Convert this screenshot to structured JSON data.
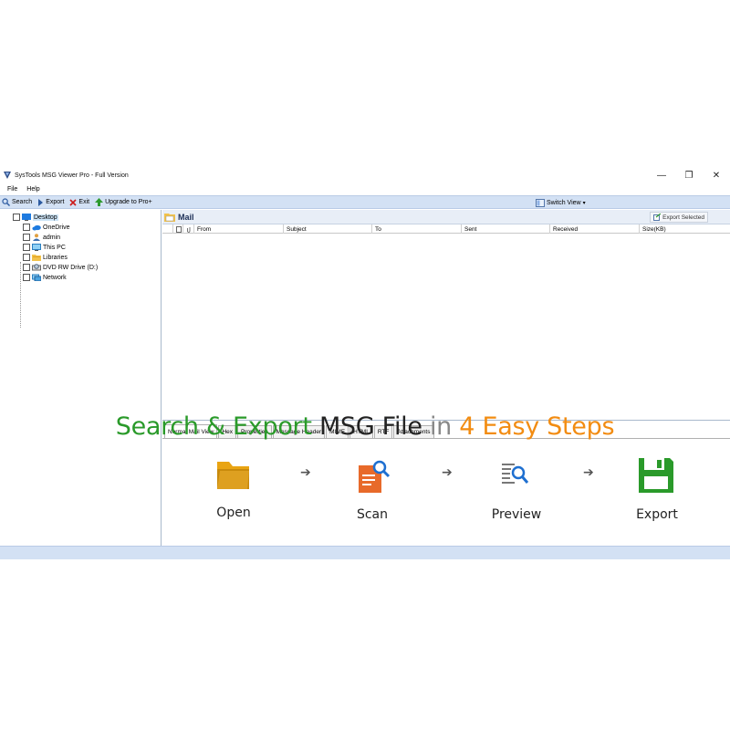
{
  "window": {
    "title": "SysTools MSG Viewer Pro - Full Version",
    "minimize_glyph": "—",
    "restore_glyph": "❐",
    "close_glyph": "✕"
  },
  "menu": [
    "File",
    "Help"
  ],
  "toolbar": {
    "search": "Search",
    "export": "Export",
    "exit": "Exit",
    "upgrade": "Upgrade to Pro+",
    "switch_view": "Switch View",
    "switch_view_caret": "▾"
  },
  "tree": [
    {
      "label": "Desktop",
      "icon": "desktop-icon",
      "selected": true
    },
    {
      "label": "OneDrive",
      "icon": "cloud-icon"
    },
    {
      "label": "admin",
      "icon": "user-icon"
    },
    {
      "label": "This PC",
      "icon": "computer-icon"
    },
    {
      "label": "Libraries",
      "icon": "folder-icon"
    },
    {
      "label": "DVD RW Drive (D:)",
      "icon": "dvd-drive-icon"
    },
    {
      "label": "Network",
      "icon": "network-icon"
    }
  ],
  "mail": {
    "title": "Mail",
    "export_selected": "Export Selected",
    "columns": [
      "From",
      "Subject",
      "To",
      "Sent",
      "Received",
      "Size(KB)"
    ]
  },
  "tabs": [
    "Normal Mail View",
    "Hex",
    "Properties",
    "Message Header",
    "MIME",
    "HTML",
    "RTF",
    "Attachments"
  ],
  "banner": {
    "part1": "Search & Export",
    "part2": "MSG File",
    "part3": "in",
    "part4": "4 Easy Steps",
    "arrow": "➔",
    "steps": [
      {
        "label": "Open",
        "icon": "folder-icon"
      },
      {
        "label": "Scan",
        "icon": "scan-document-icon"
      },
      {
        "label": "Preview",
        "icon": "preview-document-icon"
      },
      {
        "label": "Export",
        "icon": "save-disk-icon"
      }
    ]
  },
  "colors": {
    "toolbar_bg": "#d3e1f4",
    "green": "#2a9a2a",
    "orange": "#f28c12"
  }
}
